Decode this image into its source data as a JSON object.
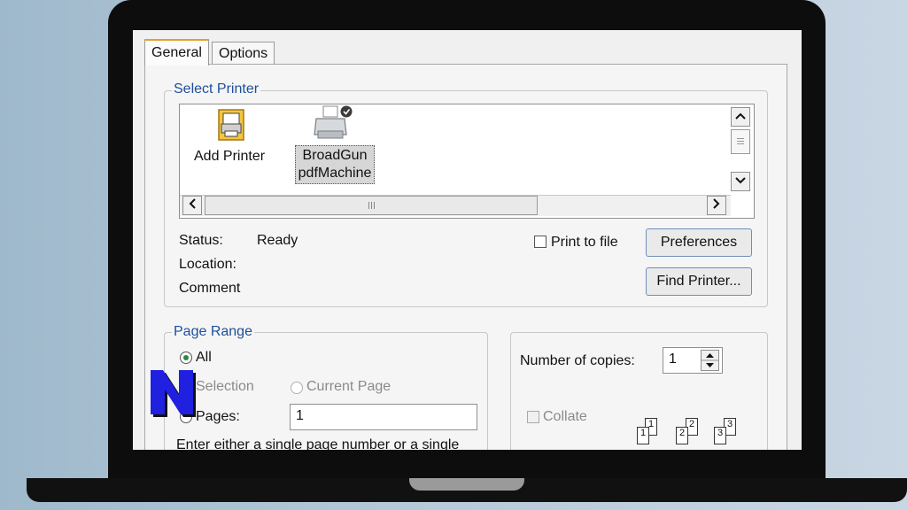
{
  "tabs": [
    {
      "label": "General",
      "active": true
    },
    {
      "label": "Options",
      "active": false
    }
  ],
  "select_printer": {
    "title": "Select Printer",
    "printers": [
      {
        "name_line1": "Add Printer",
        "name_line2": "",
        "icon": "add-printer-icon"
      },
      {
        "name_line1": "BroadGun",
        "name_line2": "pdfMachine",
        "icon": "printer-icon",
        "selected": true
      }
    ],
    "status_label": "Status:",
    "status_value": "Ready",
    "location_label": "Location:",
    "comment_label": "Comment",
    "print_to_file_label": "Print to file",
    "preferences_button": "Preferences",
    "find_printer_button": "Find Printer..."
  },
  "page_range": {
    "title": "Page Range",
    "all_label": "All",
    "selection_label": "Selection",
    "current_page_label": "Current Page",
    "pages_label": "Pages:",
    "pages_value": "1",
    "hint": "Enter either a single page number or a single"
  },
  "copies": {
    "number_label": "Number of copies:",
    "number_value": "1",
    "collate_label": "Collate",
    "collate_icons": [
      "1",
      "1",
      "2",
      "2",
      "3",
      "3"
    ]
  },
  "colors": {
    "group_title": "#1f4f9a",
    "button_border": "#6f8fb8",
    "tab_highlight": "#e3a12a",
    "radio_selected": "#2a8a3a",
    "overlay_logo": "#2020e0"
  },
  "overlay_logo_text": "N"
}
